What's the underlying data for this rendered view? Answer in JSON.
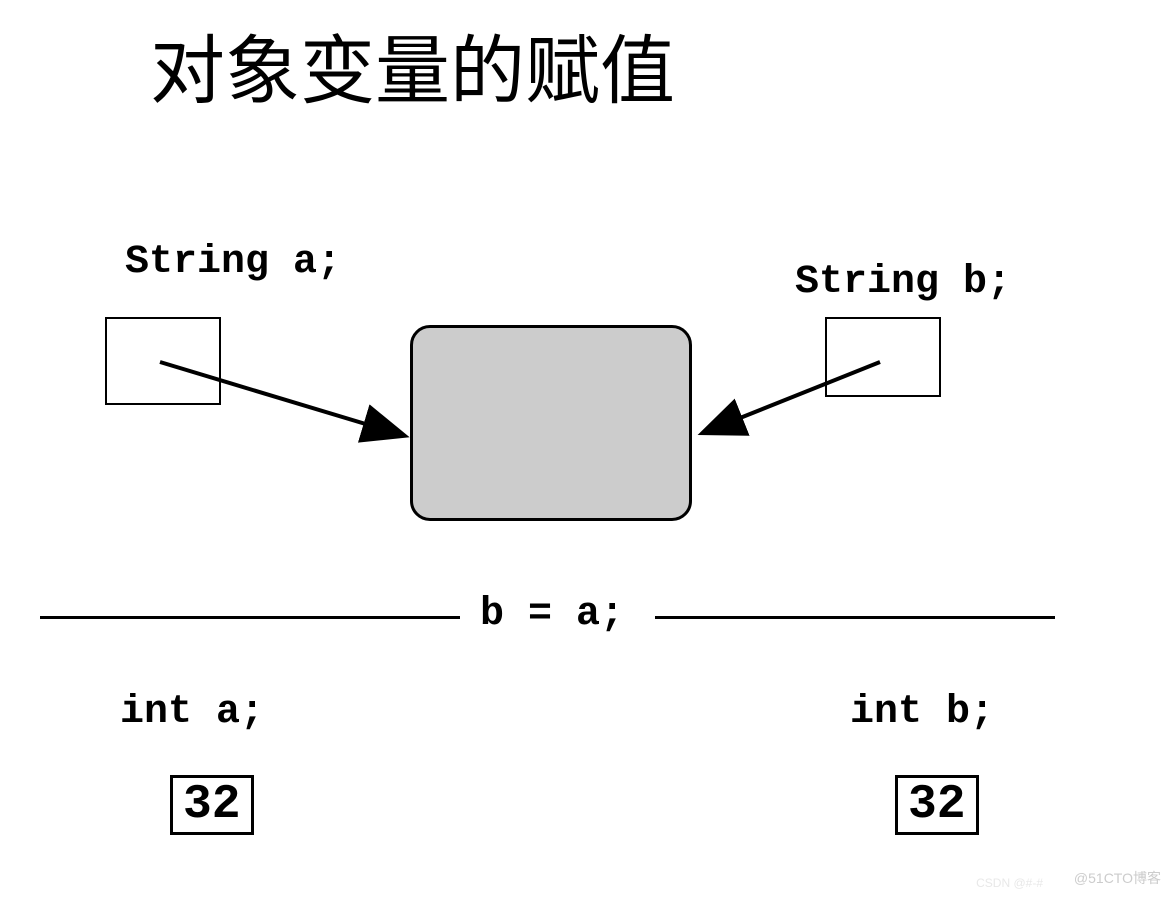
{
  "title": "对象变量的赋值",
  "string_a_label": "String a;",
  "string_b_label": "String b;",
  "assignment": "b = a;",
  "int_a_label": "int a;",
  "int_b_label": "int b;",
  "value_a": "32",
  "value_b": "32",
  "watermark1": "@51CTO博客",
  "watermark2": "CSDN @#-#"
}
